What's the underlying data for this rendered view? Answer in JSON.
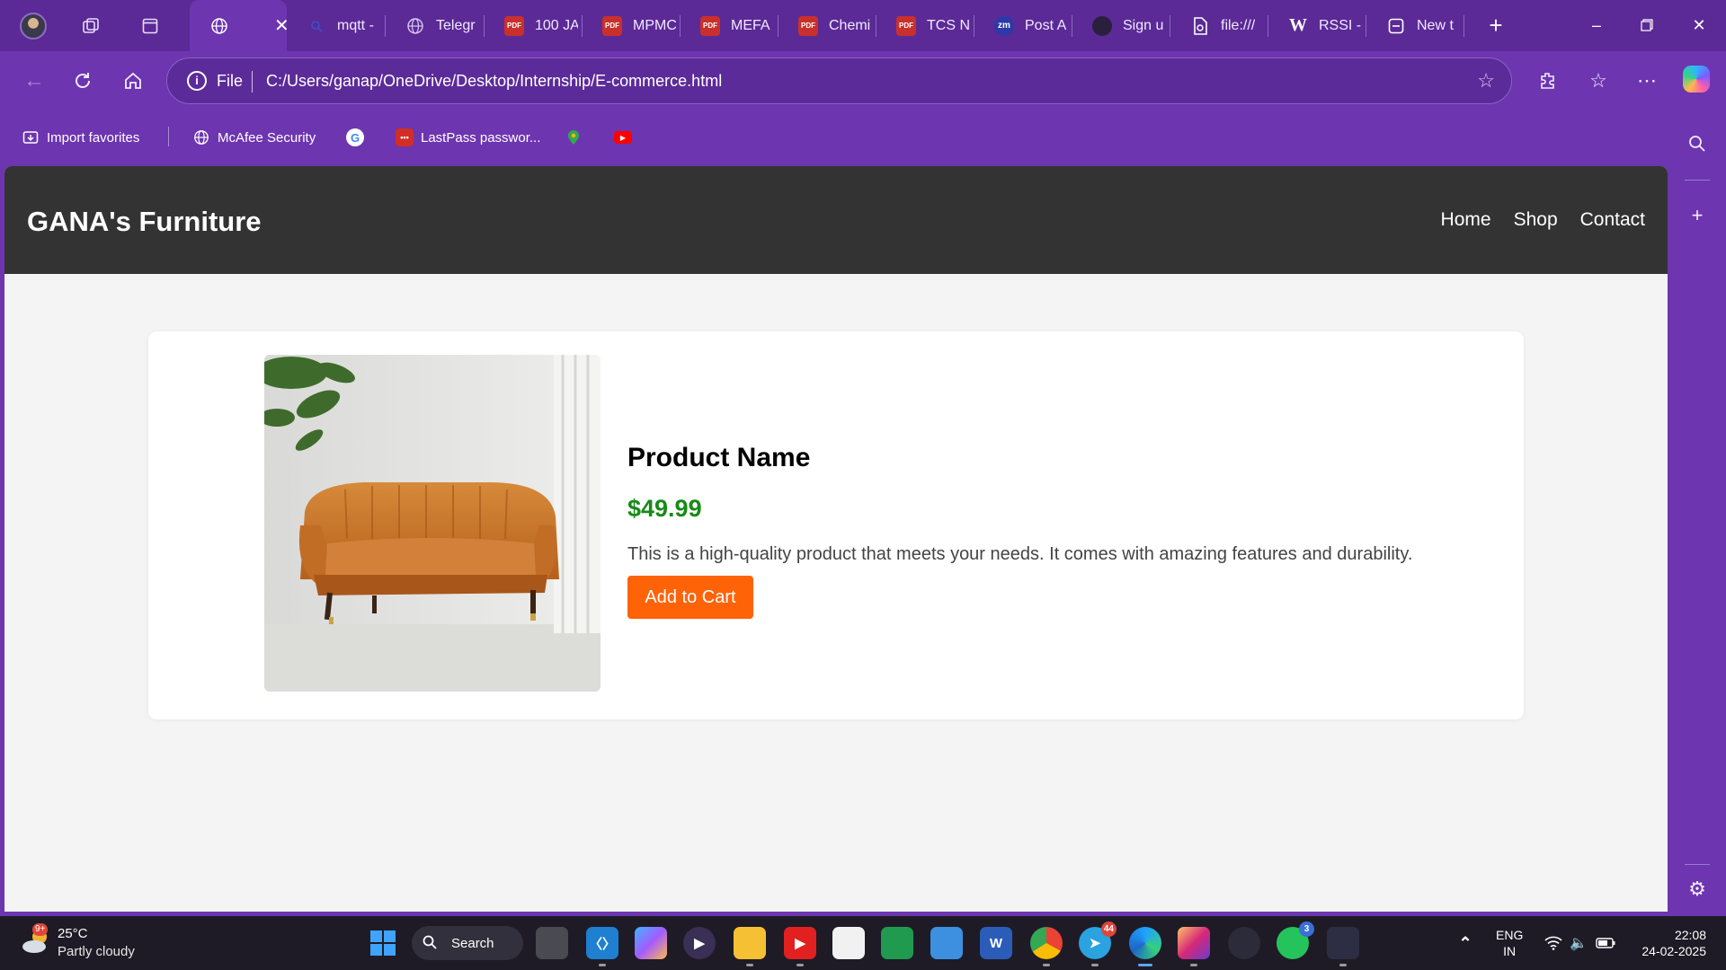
{
  "browser": {
    "tabs": [
      {
        "title": "",
        "icon": "globe-icon",
        "active": true,
        "close_glyph": "✕"
      },
      {
        "title": "mqtt -",
        "icon": "search-icon"
      },
      {
        "title": "Telegr",
        "icon": "globe-icon"
      },
      {
        "title": "100 JA",
        "icon": "pdf-icon"
      },
      {
        "title": "MPMC",
        "icon": "pdf-icon"
      },
      {
        "title": "MEFA",
        "icon": "pdf-icon"
      },
      {
        "title": "Chemi",
        "icon": "pdf-icon"
      },
      {
        "title": "TCS N",
        "icon": "pdf-icon"
      },
      {
        "title": "Post A",
        "icon": "zm-icon",
        "fav_text": "zm"
      },
      {
        "title": "Sign u",
        "icon": "circle-icon"
      },
      {
        "title": "file:///",
        "icon": "file-icon"
      },
      {
        "title": "RSSI -",
        "icon": "wikipedia-icon",
        "fav_text": "W"
      },
      {
        "title": "New t",
        "icon": "newtab-icon"
      }
    ],
    "address": {
      "scheme_label": "File",
      "url": "C:/Users/ganap/OneDrive/Desktop/Internship/E-commerce.html"
    },
    "favorites": [
      {
        "label": "Import favorites",
        "icon": "import-icon"
      },
      {
        "label": "McAfee Security",
        "icon": "globe-icon"
      },
      {
        "label": "",
        "icon": "google-icon"
      },
      {
        "label": "LastPass passwor...",
        "icon": "lastpass-icon"
      },
      {
        "label": "",
        "icon": "maps-icon"
      },
      {
        "label": "",
        "icon": "youtube-icon"
      }
    ],
    "colors": {
      "frame": "#6d35b0",
      "tabstrip": "#5b2a96"
    }
  },
  "page": {
    "site_title": "GANA's Furniture",
    "nav": [
      "Home",
      "Shop",
      "Contact"
    ],
    "product": {
      "name": "Product Name",
      "price": "$49.99",
      "description": "This is a high-quality product that meets your needs. It comes with amazing features and durability.",
      "cta": "Add to Cart"
    },
    "colors": {
      "header": "#333333",
      "price": "#178a17",
      "cta": "#ff6308",
      "background": "#f4f4f4"
    }
  },
  "taskbar": {
    "weather": {
      "temp": "25°C",
      "desc": "Partly cloudy",
      "badge": "9+"
    },
    "search_label": "Search",
    "apps": [
      {
        "name": "task-view-icon"
      },
      {
        "name": "vscode-icon"
      },
      {
        "name": "copilot-app-icon"
      },
      {
        "name": "media-player-icon"
      },
      {
        "name": "file-explorer-icon"
      },
      {
        "name": "youtube-app-icon"
      },
      {
        "name": "microsoft-store-icon"
      },
      {
        "name": "classroom-icon"
      },
      {
        "name": "photos-icon"
      },
      {
        "name": "word-icon",
        "label": "W"
      },
      {
        "name": "chrome-icon"
      },
      {
        "name": "telegram-icon",
        "badge": "44"
      },
      {
        "name": "edge-icon"
      },
      {
        "name": "instagram-icon"
      },
      {
        "name": "app-icon"
      },
      {
        "name": "whatsapp-icon",
        "badge": "3"
      },
      {
        "name": "calendar-app-icon"
      }
    ],
    "language": {
      "line1": "ENG",
      "line2": "IN"
    },
    "clock": {
      "time": "22:08",
      "date": "24-02-2025"
    }
  }
}
